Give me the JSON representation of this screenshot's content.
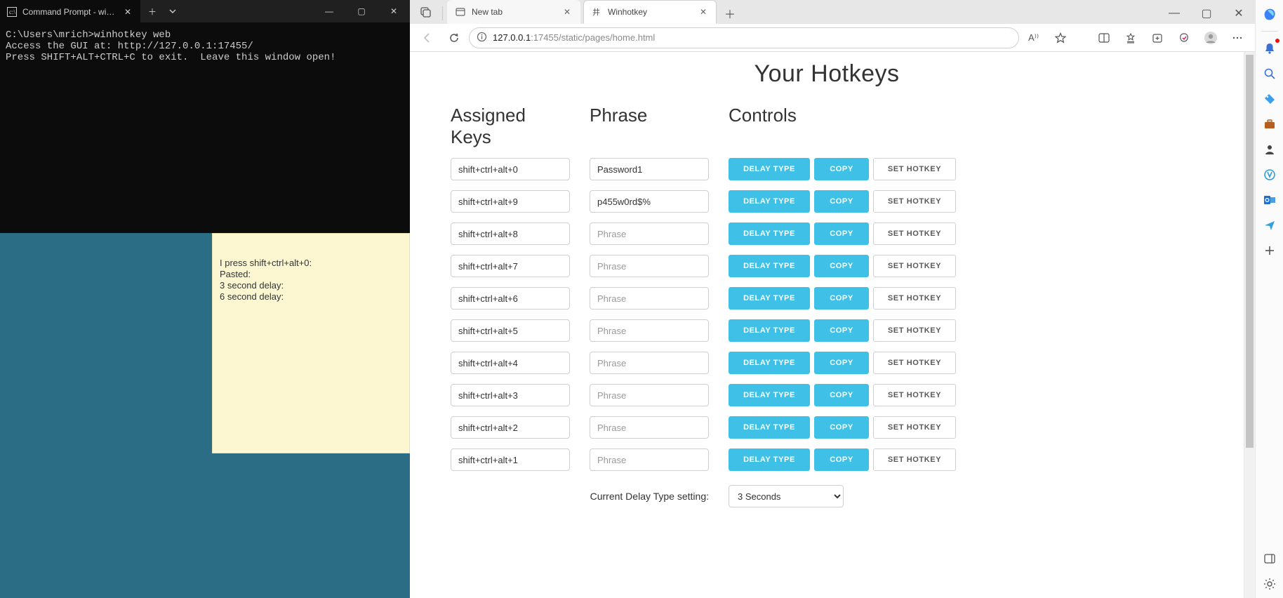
{
  "terminal": {
    "tab_title": "Command Prompt - winhotke",
    "lines": "C:\\Users\\mrich>winhotkey web\nAccess the GUI at: http://127.0.0.1:17455/\nPress SHIFT+ALT+CTRL+C to exit.  Leave this window open!"
  },
  "sticky": {
    "l1": "I press shift+ctrl+alt+0:",
    "l2": "Pasted:",
    "l3": "3 second delay:",
    "l4": "6 second delay:"
  },
  "browser": {
    "tabs": [
      {
        "title": "New tab",
        "active": false
      },
      {
        "title": "Winhotkey",
        "active": true
      }
    ],
    "url_host": "127.0.0.1",
    "url_rest": ":17455/static/pages/home.html",
    "window_controls": {
      "min": "—",
      "max": "▢",
      "close": "✕"
    }
  },
  "page": {
    "title": "Your Hotkeys",
    "headers": {
      "a": "Assigned Keys",
      "b": "Phrase",
      "c": "Controls"
    },
    "placeholder": "Phrase",
    "btn_delay": "DELAY TYPE",
    "btn_copy": "COPY",
    "btn_set": "SET HOTKEY",
    "rows": [
      {
        "key": "shift+ctrl+alt+0",
        "phrase": "Password1"
      },
      {
        "key": "shift+ctrl+alt+9",
        "phrase": "p455w0rd$%"
      },
      {
        "key": "shift+ctrl+alt+8",
        "phrase": ""
      },
      {
        "key": "shift+ctrl+alt+7",
        "phrase": ""
      },
      {
        "key": "shift+ctrl+alt+6",
        "phrase": ""
      },
      {
        "key": "shift+ctrl+alt+5",
        "phrase": ""
      },
      {
        "key": "shift+ctrl+alt+4",
        "phrase": ""
      },
      {
        "key": "shift+ctrl+alt+3",
        "phrase": ""
      },
      {
        "key": "shift+ctrl+alt+2",
        "phrase": ""
      },
      {
        "key": "shift+ctrl+alt+1",
        "phrase": ""
      }
    ],
    "delay_label": "Current Delay Type setting:",
    "delay_value": "3 Seconds"
  }
}
